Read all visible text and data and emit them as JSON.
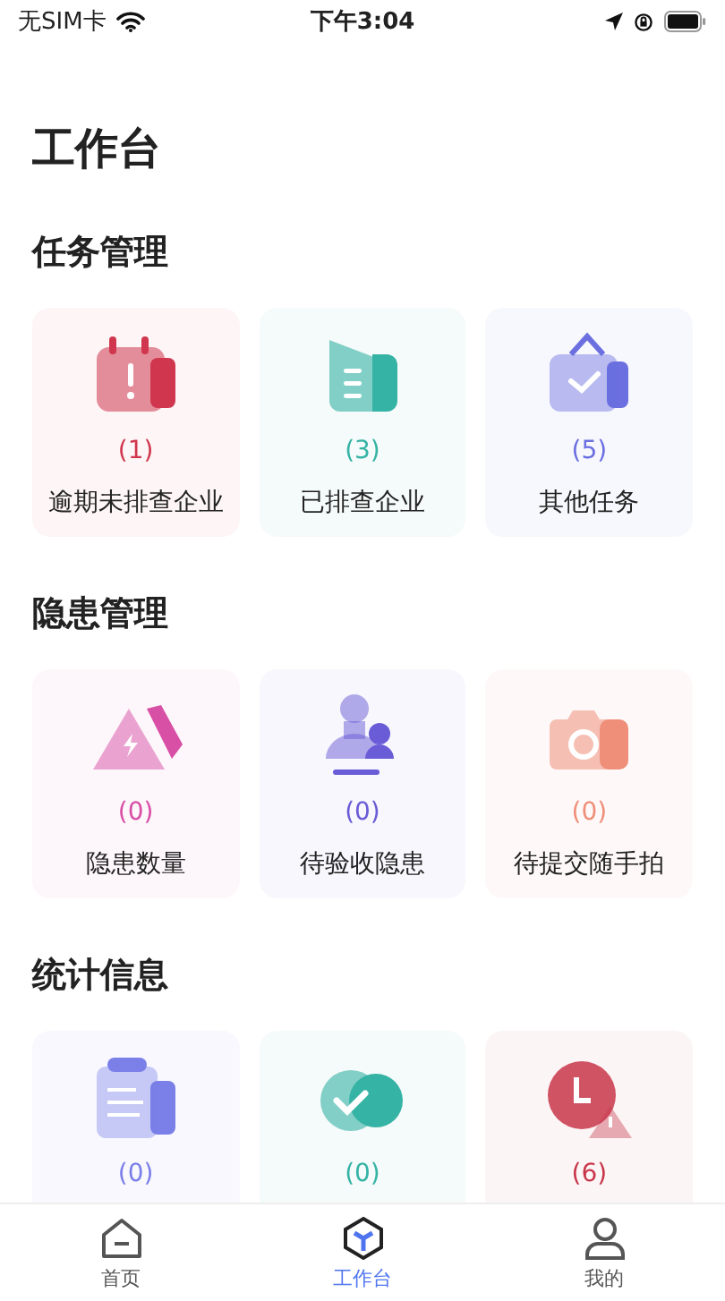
{
  "status_bar": {
    "carrier": "无SIM卡",
    "time": "下午3:04"
  },
  "page_title": "工作台",
  "sections": [
    {
      "title": "任务管理",
      "cards": [
        {
          "kind": "calendar-alert",
          "count": "(1)",
          "label": "逾期未排查企业",
          "color": "#d0374e"
        },
        {
          "kind": "document",
          "count": "(3)",
          "label": "已排查企业",
          "color": "#35b3a5"
        },
        {
          "kind": "task-check",
          "count": "(5)",
          "label": "其他任务",
          "color": "#6b6fe0"
        }
      ]
    },
    {
      "title": "隐患管理",
      "cards": [
        {
          "kind": "warning-triangle",
          "count": "(0)",
          "label": "隐患数量",
          "color": "#d84fa6"
        },
        {
          "kind": "person-stamp",
          "count": "(0)",
          "label": "待验收隐患",
          "color": "#6a5cd6"
        },
        {
          "kind": "camera",
          "count": "(0)",
          "label": "待提交随手拍",
          "color": "#ef8f7a"
        }
      ]
    },
    {
      "title": "统计信息",
      "cards": [
        {
          "kind": "clipboard",
          "count": "(0)",
          "color": "#7b7fe8"
        },
        {
          "kind": "check-circle",
          "count": "(0)",
          "color": "#35b3a5"
        },
        {
          "kind": "clock-alert",
          "count": "(6)",
          "color": "#c8364a"
        }
      ]
    }
  ],
  "tab_bar": [
    {
      "kind": "home",
      "label": "首页",
      "selected": false
    },
    {
      "kind": "workbench",
      "label": "工作台",
      "selected": true
    },
    {
      "kind": "profile",
      "label": "我的",
      "selected": false
    }
  ]
}
